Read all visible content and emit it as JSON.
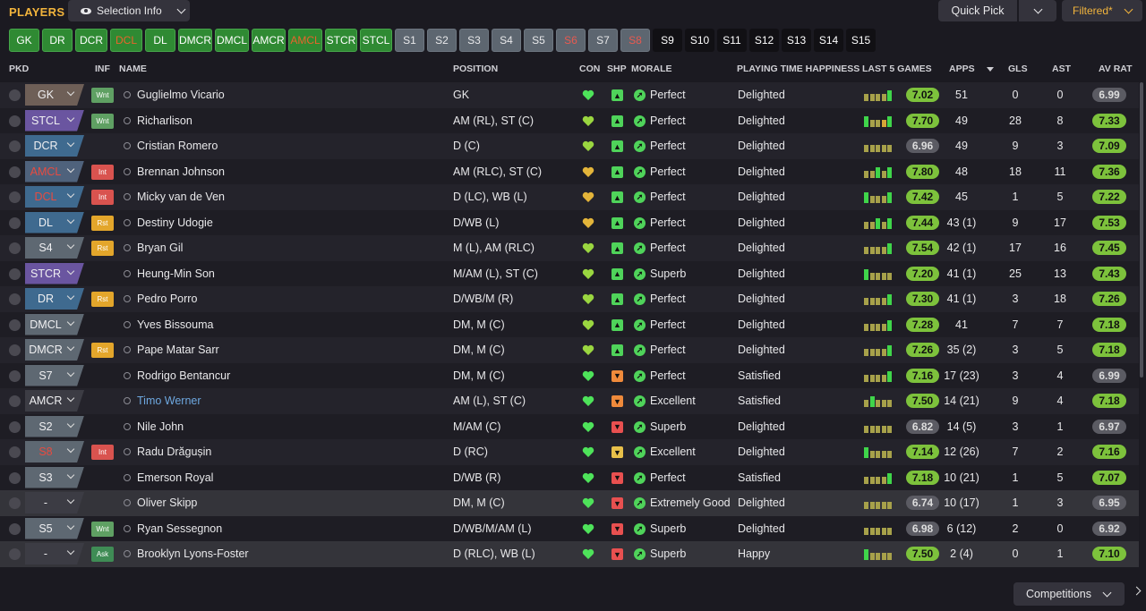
{
  "header": {
    "title": "PLAYERS",
    "selection_info": "Selection Info",
    "quick_pick": "Quick Pick",
    "filtered": "Filtered*"
  },
  "positions": [
    {
      "label": "GK",
      "style": "g"
    },
    {
      "label": "DR",
      "style": "g"
    },
    {
      "label": "DCR",
      "style": "g"
    },
    {
      "label": "DCL",
      "style": "gr"
    },
    {
      "label": "DL",
      "style": "g"
    },
    {
      "label": "DMCR",
      "style": "g"
    },
    {
      "label": "DMCL",
      "style": "g"
    },
    {
      "label": "AMCR",
      "style": "g"
    },
    {
      "label": "AMCL",
      "style": "gr"
    },
    {
      "label": "STCR",
      "style": "g"
    },
    {
      "label": "STCL",
      "style": "g"
    },
    {
      "label": "S1",
      "style": "s"
    },
    {
      "label": "S2",
      "style": "s"
    },
    {
      "label": "S3",
      "style": "s"
    },
    {
      "label": "S4",
      "style": "s"
    },
    {
      "label": "S5",
      "style": "s"
    },
    {
      "label": "S6",
      "style": "sr"
    },
    {
      "label": "S7",
      "style": "s"
    },
    {
      "label": "S8",
      "style": "sr"
    },
    {
      "label": "S9",
      "style": "d"
    },
    {
      "label": "S10",
      "style": "d"
    },
    {
      "label": "S11",
      "style": "d"
    },
    {
      "label": "S12",
      "style": "d"
    },
    {
      "label": "S13",
      "style": "d"
    },
    {
      "label": "S14",
      "style": "d"
    },
    {
      "label": "S15",
      "style": "d"
    }
  ],
  "columns": {
    "pkd": "PKD",
    "inf": "INF",
    "name": "NAME",
    "position": "POSITION",
    "con": "CON",
    "shp": "SHP",
    "morale": "MORALE",
    "pth": "PLAYING TIME HAPPINESS",
    "last5": "LAST 5 GAMES",
    "apps": "APPS",
    "gls": "GLS",
    "ast": "AST",
    "avrat": "AV RAT"
  },
  "colors": {
    "sel_gk": "#6e5f57",
    "sel_def": "#3f6a8f",
    "sel_mid": "#4f627c",
    "sel_att": "#6a55a0",
    "sel_sub": "#5e6872",
    "sel_none": "#3c3c44",
    "wnt": "#5fa063",
    "int": "#d9534f",
    "rst": "#e3a62b",
    "ask": "#3f8c55",
    "heart_green": "#4ee35a",
    "heart_yellow": "#e3b43a",
    "heart_mixed": "#9ad640",
    "shp_green": "#4fd35a",
    "shp_orange": "#ef8a3b",
    "shp_red": "#e85050",
    "shp_yellow": "#e8c04a",
    "rating_green": "#7dc23c",
    "rating_grey": "#5b5b63",
    "bar_green": "#3fd54a",
    "bar_olive": "#a7a14a",
    "bar_gold": "#d6a637"
  },
  "players": [
    {
      "sel": "GK",
      "sel_color": "sel_gk",
      "sel_red": false,
      "inf": "Wnt",
      "inf_color": "wnt",
      "name": "Guglielmo Vicario",
      "name_color": "#e8e8ea",
      "position": "GK",
      "con": "heart_green",
      "shp": "shp_green",
      "shp_icon": "▲",
      "morale": "Perfect",
      "pth": "Delighted",
      "last5": [
        "bar_olive",
        "bar_olive",
        "bar_olive",
        "bar_olive",
        "bar_green"
      ],
      "rating": "7.02",
      "rating_style": "rating_green",
      "apps": "51",
      "gls": "0",
      "ast": "0",
      "avrat": "6.99",
      "avrat_style": "rating_grey"
    },
    {
      "sel": "STCL",
      "sel_color": "sel_att",
      "sel_red": false,
      "inf": "Wnt",
      "inf_color": "wnt",
      "name": "Richarlison",
      "name_color": "#e8e8ea",
      "position": "AM (RL), ST (C)",
      "con": "heart_mixed",
      "shp": "shp_green",
      "shp_icon": "▲",
      "morale": "Perfect",
      "pth": "Delighted",
      "last5": [
        "bar_green",
        "bar_olive",
        "bar_olive",
        "bar_gold",
        "bar_green"
      ],
      "rating": "7.70",
      "rating_style": "rating_green",
      "apps": "49",
      "gls": "28",
      "ast": "8",
      "avrat": "7.33",
      "avrat_style": "rating_green"
    },
    {
      "sel": "DCR",
      "sel_color": "sel_def",
      "sel_red": false,
      "inf": "",
      "inf_color": "",
      "name": "Cristian Romero",
      "name_color": "#e8e8ea",
      "position": "D (C)",
      "con": "heart_mixed",
      "shp": "shp_green",
      "shp_icon": "▲",
      "morale": "Perfect",
      "pth": "Delighted",
      "last5": [
        "bar_olive",
        "bar_olive",
        "bar_olive",
        "bar_olive",
        "bar_olive"
      ],
      "rating": "6.96",
      "rating_style": "rating_grey",
      "apps": "49",
      "gls": "9",
      "ast": "3",
      "avrat": "7.09",
      "avrat_style": "rating_green"
    },
    {
      "sel": "AMCL",
      "sel_color": "sel_mid",
      "sel_red": true,
      "inf": "Int",
      "inf_color": "int",
      "name": "Brennan Johnson",
      "name_color": "#e8e8ea",
      "position": "AM (RLC), ST (C)",
      "con": "heart_yellow",
      "shp": "shp_green",
      "shp_icon": "▲",
      "morale": "Perfect",
      "pth": "Delighted",
      "last5": [
        "bar_olive",
        "bar_olive",
        "bar_green",
        "bar_olive",
        "bar_green"
      ],
      "rating": "7.80",
      "rating_style": "rating_green",
      "apps": "48",
      "gls": "18",
      "ast": "11",
      "avrat": "7.36",
      "avrat_style": "rating_green"
    },
    {
      "sel": "DCL",
      "sel_color": "sel_def",
      "sel_red": true,
      "inf": "Int",
      "inf_color": "int",
      "name": "Micky van de Ven",
      "name_color": "#e8e8ea",
      "position": "D (LC), WB (L)",
      "con": "heart_yellow",
      "shp": "shp_green",
      "shp_icon": "▲",
      "morale": "Perfect",
      "pth": "Delighted",
      "last5": [
        "bar_green",
        "bar_olive",
        "bar_olive",
        "bar_olive",
        "bar_green"
      ],
      "rating": "7.42",
      "rating_style": "rating_green",
      "apps": "45",
      "gls": "1",
      "ast": "5",
      "avrat": "7.22",
      "avrat_style": "rating_green"
    },
    {
      "sel": "DL",
      "sel_color": "sel_def",
      "sel_red": false,
      "inf": "Rst",
      "inf_color": "rst",
      "name": "Destiny Udogie",
      "name_color": "#e8e8ea",
      "position": "D/WB (L)",
      "con": "heart_yellow",
      "shp": "shp_green",
      "shp_icon": "▲",
      "morale": "Perfect",
      "pth": "Delighted",
      "last5": [
        "bar_olive",
        "bar_olive",
        "bar_green",
        "bar_olive",
        "bar_green"
      ],
      "rating": "7.44",
      "rating_style": "rating_green",
      "apps": "43 (1)",
      "gls": "9",
      "ast": "17",
      "avrat": "7.53",
      "avrat_style": "rating_green"
    },
    {
      "sel": "S4",
      "sel_color": "sel_sub",
      "sel_red": false,
      "inf": "Rst",
      "inf_color": "rst",
      "name": "Bryan Gil",
      "name_color": "#e8e8ea",
      "position": "M (L), AM (RLC)",
      "con": "heart_mixed",
      "shp": "shp_green",
      "shp_icon": "▲",
      "morale": "Perfect",
      "pth": "Delighted",
      "last5": [
        "bar_olive",
        "bar_olive",
        "bar_olive",
        "bar_olive",
        "bar_green"
      ],
      "rating": "7.54",
      "rating_style": "rating_green",
      "apps": "42 (1)",
      "gls": "17",
      "ast": "16",
      "avrat": "7.45",
      "avrat_style": "rating_green"
    },
    {
      "sel": "STCR",
      "sel_color": "sel_att",
      "sel_red": false,
      "inf": "",
      "inf_color": "",
      "name": "Heung-Min Son",
      "name_color": "#e8e8ea",
      "position": "M/AM (L), ST (C)",
      "con": "heart_mixed",
      "shp": "shp_green",
      "shp_icon": "▲",
      "morale": "Superb",
      "pth": "Delighted",
      "last5": [
        "bar_green",
        "bar_olive",
        "bar_olive",
        "bar_olive",
        "bar_olive"
      ],
      "rating": "7.20",
      "rating_style": "rating_green",
      "apps": "41 (1)",
      "gls": "25",
      "ast": "13",
      "avrat": "7.43",
      "avrat_style": "rating_green"
    },
    {
      "sel": "DR",
      "sel_color": "sel_def",
      "sel_red": false,
      "inf": "Rst",
      "inf_color": "rst",
      "name": "Pedro Porro",
      "name_color": "#e8e8ea",
      "position": "D/WB/M (R)",
      "con": "heart_mixed",
      "shp": "shp_green",
      "shp_icon": "▲",
      "morale": "Perfect",
      "pth": "Delighted",
      "last5": [
        "bar_olive",
        "bar_olive",
        "bar_olive",
        "bar_olive",
        "bar_green"
      ],
      "rating": "7.30",
      "rating_style": "rating_green",
      "apps": "41 (1)",
      "gls": "3",
      "ast": "18",
      "avrat": "7.26",
      "avrat_style": "rating_green"
    },
    {
      "sel": "DMCL",
      "sel_color": "sel_sub",
      "sel_red": false,
      "inf": "",
      "inf_color": "",
      "name": "Yves Bissouma",
      "name_color": "#e8e8ea",
      "position": "DM, M (C)",
      "con": "heart_mixed",
      "shp": "shp_green",
      "shp_icon": "▲",
      "morale": "Perfect",
      "pth": "Delighted",
      "last5": [
        "bar_olive",
        "bar_olive",
        "bar_olive",
        "bar_olive",
        "bar_green"
      ],
      "rating": "7.28",
      "rating_style": "rating_green",
      "apps": "41",
      "gls": "7",
      "ast": "7",
      "avrat": "7.18",
      "avrat_style": "rating_green"
    },
    {
      "sel": "DMCR",
      "sel_color": "sel_sub",
      "sel_red": false,
      "inf": "Rst",
      "inf_color": "rst",
      "name": "Pape Matar Sarr",
      "name_color": "#e8e8ea",
      "position": "DM, M (C)",
      "con": "heart_mixed",
      "shp": "shp_green",
      "shp_icon": "▲",
      "morale": "Perfect",
      "pth": "Delighted",
      "last5": [
        "bar_olive",
        "bar_olive",
        "bar_olive",
        "bar_olive",
        "bar_green"
      ],
      "rating": "7.26",
      "rating_style": "rating_green",
      "apps": "35 (2)",
      "gls": "3",
      "ast": "5",
      "avrat": "7.18",
      "avrat_style": "rating_green"
    },
    {
      "sel": "S7",
      "sel_color": "sel_sub",
      "sel_red": false,
      "inf": "",
      "inf_color": "",
      "name": "Rodrigo Bentancur",
      "name_color": "#e8e8ea",
      "position": "DM, M (C)",
      "con": "heart_green",
      "shp": "shp_orange",
      "shp_icon": "▼",
      "morale": "Perfect",
      "pth": "Satisfied",
      "last5": [
        "bar_olive",
        "bar_olive",
        "bar_olive",
        "bar_olive",
        "bar_green"
      ],
      "rating": "7.16",
      "rating_style": "rating_green",
      "apps": "17 (23)",
      "gls": "3",
      "ast": "4",
      "avrat": "6.99",
      "avrat_style": "rating_grey"
    },
    {
      "sel": "AMCR",
      "sel_color": "sel_none",
      "sel_red": false,
      "inf": "",
      "inf_color": "",
      "name": "Timo Werner",
      "name_color": "#6ea8e0",
      "position": "AM (L), ST (C)",
      "con": "heart_green",
      "shp": "shp_orange",
      "shp_icon": "▼",
      "morale": "Excellent",
      "pth": "Satisfied",
      "last5": [
        "bar_olive",
        "bar_green",
        "bar_olive",
        "bar_olive",
        "bar_olive"
      ],
      "rating": "7.50",
      "rating_style": "rating_green",
      "apps": "14 (21)",
      "gls": "9",
      "ast": "4",
      "avrat": "7.18",
      "avrat_style": "rating_green"
    },
    {
      "sel": "S2",
      "sel_color": "sel_sub",
      "sel_red": false,
      "inf": "",
      "inf_color": "",
      "name": "Nile John",
      "name_color": "#e8e8ea",
      "position": "M/AM (C)",
      "con": "heart_green",
      "shp": "shp_red",
      "shp_icon": "▼",
      "morale": "Superb",
      "pth": "Delighted",
      "last5": [
        "bar_olive",
        "bar_olive",
        "bar_olive",
        "bar_olive",
        "bar_olive"
      ],
      "rating": "6.82",
      "rating_style": "rating_grey",
      "apps": "14 (5)",
      "gls": "3",
      "ast": "1",
      "avrat": "6.97",
      "avrat_style": "rating_grey"
    },
    {
      "sel": "S8",
      "sel_color": "sel_sub",
      "sel_red": true,
      "inf": "Int",
      "inf_color": "int",
      "name": "Radu Drăgușin",
      "name_color": "#e8e8ea",
      "position": "D (RC)",
      "con": "heart_green",
      "shp": "shp_yellow",
      "shp_icon": "▼",
      "morale": "Excellent",
      "pth": "Delighted",
      "last5": [
        "bar_green",
        "bar_olive",
        "bar_olive",
        "bar_olive",
        "bar_olive"
      ],
      "rating": "7.14",
      "rating_style": "rating_green",
      "apps": "12 (26)",
      "gls": "7",
      "ast": "2",
      "avrat": "7.16",
      "avrat_style": "rating_green"
    },
    {
      "sel": "S3",
      "sel_color": "sel_sub",
      "sel_red": false,
      "inf": "",
      "inf_color": "",
      "name": "Emerson Royal",
      "name_color": "#e8e8ea",
      "position": "D/WB (R)",
      "con": "heart_green",
      "shp": "shp_red",
      "shp_icon": "▼",
      "morale": "Perfect",
      "pth": "Satisfied",
      "last5": [
        "bar_olive",
        "bar_olive",
        "bar_olive",
        "bar_olive",
        "bar_green"
      ],
      "rating": "7.18",
      "rating_style": "rating_green",
      "apps": "10 (21)",
      "gls": "1",
      "ast": "5",
      "avrat": "7.07",
      "avrat_style": "rating_green"
    },
    {
      "sel": "-",
      "sel_color": "sel_none",
      "sel_red": false,
      "inf": "",
      "inf_color": "",
      "name": "Oliver Skipp",
      "name_color": "#e8e8ea",
      "position": "DM, M (C)",
      "con": "heart_green",
      "shp": "shp_red",
      "shp_icon": "▼",
      "morale": "Extremely Good",
      "pth": "Delighted",
      "last5": [
        "bar_olive",
        "bar_olive",
        "bar_olive",
        "bar_olive",
        "bar_olive"
      ],
      "rating": "6.74",
      "rating_style": "rating_grey",
      "apps": "10 (17)",
      "gls": "1",
      "ast": "3",
      "avrat": "6.95",
      "avrat_style": "rating_grey",
      "highlight": true
    },
    {
      "sel": "S5",
      "sel_color": "sel_sub",
      "sel_red": false,
      "inf": "Wnt",
      "inf_color": "wnt",
      "name": "Ryan Sessegnon",
      "name_color": "#e8e8ea",
      "position": "D/WB/M/AM (L)",
      "con": "heart_green",
      "shp": "shp_red",
      "shp_icon": "▼",
      "morale": "Superb",
      "pth": "Delighted",
      "last5": [
        "bar_olive",
        "bar_olive",
        "bar_olive",
        "bar_olive",
        "bar_olive"
      ],
      "rating": "6.98",
      "rating_style": "rating_grey",
      "apps": "6 (12)",
      "gls": "2",
      "ast": "0",
      "avrat": "6.92",
      "avrat_style": "rating_grey"
    },
    {
      "sel": "-",
      "sel_color": "sel_none",
      "sel_red": false,
      "inf": "Ask",
      "inf_color": "ask",
      "name": "Brooklyn Lyons-Foster",
      "name_color": "#e8e8ea",
      "position": "D (RLC), WB (L)",
      "con": "heart_green",
      "shp": "shp_red",
      "shp_icon": "▼",
      "morale": "Superb",
      "pth": "Happy",
      "last5": [
        "bar_green",
        "bar_olive",
        "bar_olive",
        "bar_olive",
        "bar_olive"
      ],
      "rating": "7.50",
      "rating_style": "rating_green",
      "apps": "2 (4)",
      "gls": "0",
      "ast": "1",
      "avrat": "7.10",
      "avrat_style": "rating_green",
      "highlight": true
    }
  ],
  "footer": {
    "competitions": "Competitions"
  }
}
